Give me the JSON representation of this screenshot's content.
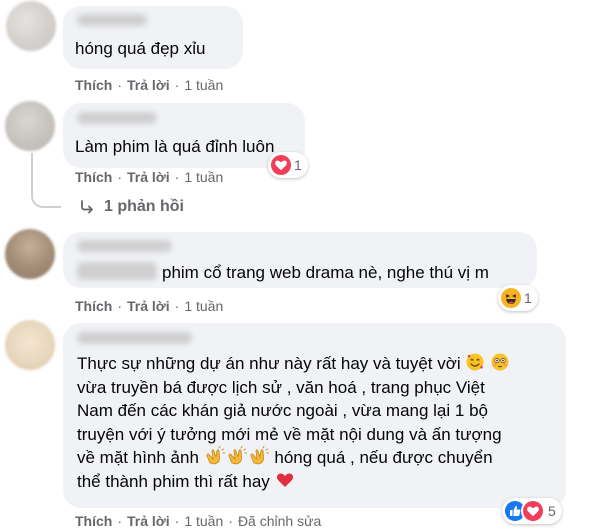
{
  "colors": {
    "bubble": "#f0f2f5",
    "meta_text": "#65676b",
    "love": "#f33e58",
    "like": "#1877f2",
    "haha": "#f7b125"
  },
  "comments": [
    {
      "text": "hóng quá đẹp xỉu",
      "actions": {
        "like": "Thích",
        "reply": "Trả lời",
        "time": "1 tuần"
      }
    },
    {
      "text": "Làm phim là quá đỉnh luôn",
      "reaction": {
        "icons": [
          "love-icon"
        ],
        "count": "1"
      },
      "actions": {
        "like": "Thích",
        "reply": "Trả lời",
        "time": "1 tuần"
      },
      "replies_link": "1 phản hồi"
    },
    {
      "text": "phim cổ trang web drama nè, nghe thú vị m",
      "reaction": {
        "icons": [
          "haha-icon"
        ],
        "count": "1"
      },
      "actions": {
        "like": "Thích",
        "reply": "Trả lời",
        "time": "1 tuần"
      }
    },
    {
      "lines": [
        "Thực sự những dự án như này rất hay và tuyệt vời",
        "vừa truyền bá được lịch sử , văn hoá , trang phục Việt",
        "Nam đến các khán giả nước ngoài , vừa mang lại 1 bộ",
        "truyện với ý tưởng mới mẻ về mặt nội dung và ấn tượng",
        "về mặt hình ảnh",
        "hóng quá , nếu được chuyển",
        "thể thành phim thì rất hay"
      ],
      "reaction": {
        "icons": [
          "like-icon",
          "love-icon"
        ],
        "count": "5"
      },
      "actions": {
        "like": "Thích",
        "reply": "Trả lời",
        "time": "1 tuần",
        "edited": "Đã chỉnh sửa"
      }
    }
  ]
}
